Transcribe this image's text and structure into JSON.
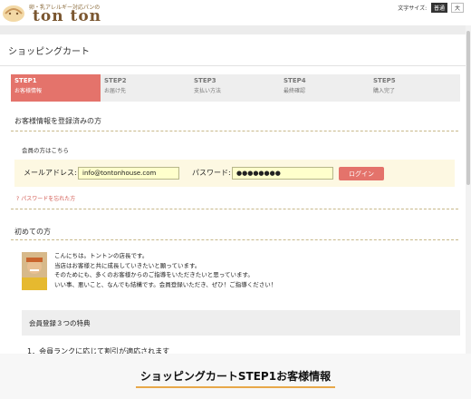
{
  "header": {
    "logo_tagline": "卵・乳アレルギー対応パンの",
    "logo_name": "ton ton",
    "text_size_label": "文字サイズ:",
    "text_size_standard": "普通",
    "text_size_large": "大"
  },
  "cart": {
    "title": "ショッピングカート",
    "steps": [
      {
        "num": "STEP1",
        "label": "お客様情報"
      },
      {
        "num": "STEP2",
        "label": "お届け先"
      },
      {
        "num": "STEP3",
        "label": "支払い方法"
      },
      {
        "num": "STEP4",
        "label": "最終確認"
      },
      {
        "num": "STEP5",
        "label": "購入完了"
      }
    ],
    "active_step": 1
  },
  "registered": {
    "section_title": "お客様情報を登録済みの方",
    "member_label": "会員の方はこちら",
    "email_label": "メールアドレス:",
    "email_value": "info@tontonhouse.com",
    "password_label": "パスワード:",
    "password_value": "●●●●●●●●",
    "login_button": "ログイン",
    "forgot_link": "パスワードを忘れた方"
  },
  "first_time": {
    "section_title": "初めての方",
    "greeting_lines": [
      "こんにちは。トントンの店長です。",
      "当店はお客様と共に成長していきたいと願っています。",
      "そのためにも、多くのお客様からのご指導をいただきたいと思っています。",
      "いい事、悪いこと、なんでも結構です。会員登録いただき、ぜひ！ご指導ください！"
    ],
    "benefits_title": "会員登録３つの特典",
    "benefit_1": "1．会員ランクに応じて割引が適応されます"
  },
  "caption": "ショッピングカートSTEP1お客様情報",
  "colors": {
    "accent": "#e4736b",
    "logo_brown": "#7a5630",
    "input_bg": "#ffffcc"
  }
}
